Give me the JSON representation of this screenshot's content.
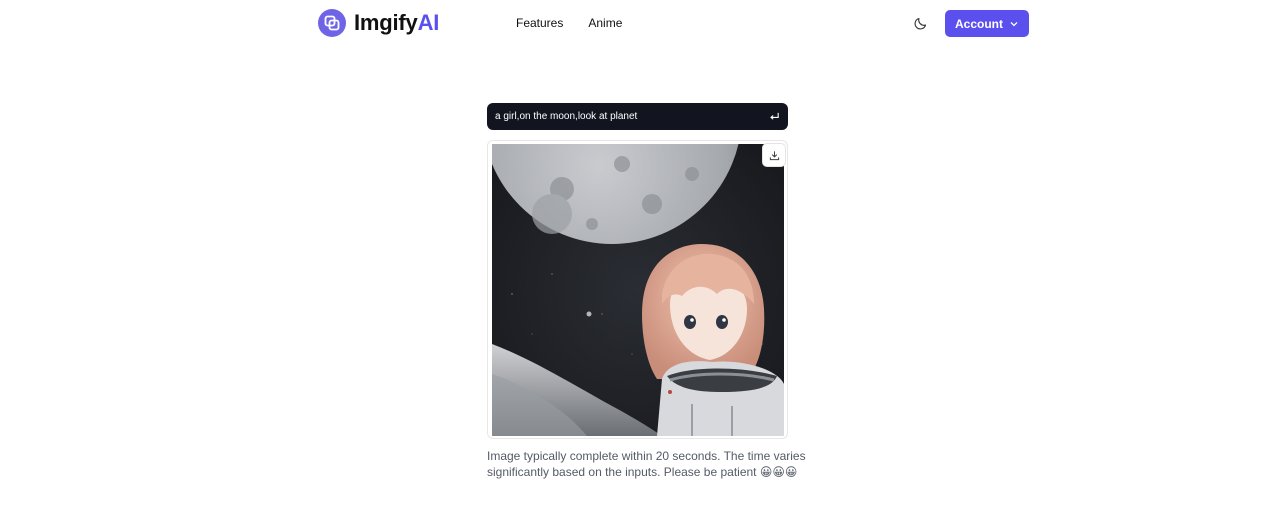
{
  "header": {
    "brand_name": "Imgify",
    "brand_suffix": "AI",
    "nav": [
      {
        "label": "Features"
      },
      {
        "label": "Anime"
      }
    ],
    "account_label": "Account"
  },
  "prompt": {
    "value": "a girl,on the moon,look at planet"
  },
  "result": {
    "note": "Image typically complete within 20 seconds. The time varies significantly based on the inputs. Please be patient 😀😀😀"
  },
  "icons": {
    "logo": "logo-mark-icon",
    "theme": "moon-icon",
    "account_chevron": "chevron-down-icon",
    "submit": "enter-icon",
    "download": "download-icon"
  },
  "colors": {
    "brand": "#5b50ee",
    "prompt_bg": "#121420"
  }
}
